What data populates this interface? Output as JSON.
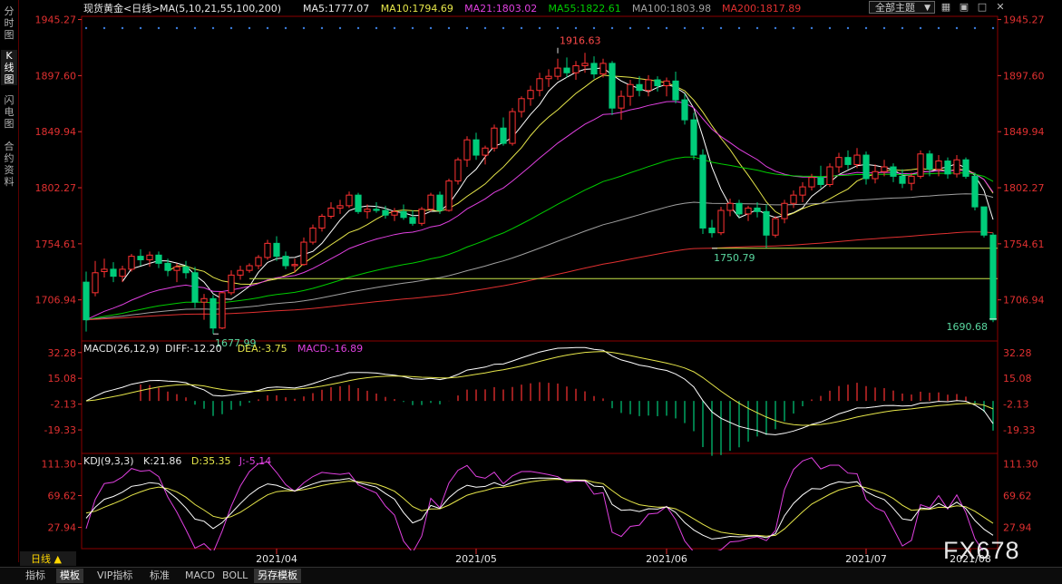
{
  "sidebar": {
    "tabs": [
      {
        "label": "分时图",
        "active": false
      },
      {
        "label": "K线图",
        "active": true
      },
      {
        "label": "闪电图",
        "active": false
      },
      {
        "label": "合约资料",
        "active": false
      }
    ]
  },
  "toolbar": {
    "theme_select": "全部主题",
    "theme_arrow": "▼",
    "icons": [
      "grid-icon",
      "chart-type-icon",
      "fullscreen-icon",
      "close-icon"
    ]
  },
  "bottom_tabs": [
    "指标",
    "模板",
    "VIP指标",
    "标准",
    "MACD",
    "BOLL",
    "另存模板"
  ],
  "bottom_active": "模板",
  "period": {
    "label": "日线 ▲"
  },
  "watermark": "FX678",
  "colors": {
    "up": "#ff3232",
    "down": "#00cc7a",
    "ma5": "#ffffff",
    "ma10": "#e6e64a",
    "ma21": "#e040e0",
    "ma55": "#00cc00",
    "ma100": "#a0a0a0",
    "ma200": "#e03030",
    "axis": "#e03030",
    "frame": "#8b0000"
  },
  "chart_data": [
    {
      "type": "candlestick",
      "title": "现货黄金<日线>",
      "ma_header": "MA(5,10,21,55,100,200)",
      "ma_values": [
        {
          "name": "MA5",
          "value": "1777.07"
        },
        {
          "name": "MA10",
          "value": "1794.69"
        },
        {
          "name": "MA21",
          "value": "1803.02"
        },
        {
          "name": "MA55",
          "value": "1822.61"
        },
        {
          "name": "MA100",
          "value": "1803.98"
        },
        {
          "name": "MA200",
          "value": "1817.89"
        }
      ],
      "yticks": [
        "1945.27",
        "1897.60",
        "1849.94",
        "1802.27",
        "1754.61",
        "1706.94"
      ],
      "ylim": [
        1672,
        1948
      ],
      "xticks": [
        "2021/04",
        "2021/05",
        "2021/06",
        "2021/07",
        "2021/08"
      ],
      "annotations": [
        {
          "text": "1916.63",
          "value": 1916.63,
          "index": 52
        },
        {
          "text": "1677.99",
          "value": 1677.99,
          "index": 14
        },
        {
          "text": "1750.79",
          "value": 1750.79,
          "index": 69
        },
        {
          "text": "1690.68",
          "value": 1690.68,
          "index": 100
        }
      ],
      "hlines": [
        1750.79,
        1725
      ],
      "ohlc": [
        [
          1722,
          1731,
          1680,
          1690
        ],
        [
          1713,
          1740,
          1710,
          1730
        ],
        [
          1731,
          1742,
          1726,
          1733
        ],
        [
          1733,
          1739,
          1722,
          1727
        ],
        [
          1727,
          1736,
          1722,
          1733
        ],
        [
          1733,
          1746,
          1731,
          1744
        ],
        [
          1744,
          1750,
          1736,
          1741
        ],
        [
          1741,
          1748,
          1735,
          1745
        ],
        [
          1745,
          1748,
          1734,
          1738
        ],
        [
          1738,
          1742,
          1727,
          1732
        ],
        [
          1732,
          1738,
          1722,
          1735
        ],
        [
          1735,
          1740,
          1725,
          1730
        ],
        [
          1730,
          1735,
          1700,
          1705
        ],
        [
          1705,
          1712,
          1690,
          1708
        ],
        [
          1708,
          1711,
          1678,
          1683
        ],
        [
          1683,
          1714,
          1682,
          1713
        ],
        [
          1713,
          1732,
          1711,
          1728
        ],
        [
          1728,
          1736,
          1724,
          1732
        ],
        [
          1732,
          1738,
          1730,
          1736
        ],
        [
          1736,
          1745,
          1733,
          1743
        ],
        [
          1743,
          1758,
          1741,
          1755
        ],
        [
          1755,
          1761,
          1740,
          1744
        ],
        [
          1744,
          1748,
          1733,
          1736
        ],
        [
          1736,
          1742,
          1730,
          1737
        ],
        [
          1737,
          1760,
          1736,
          1756
        ],
        [
          1756,
          1771,
          1754,
          1768
        ],
        [
          1768,
          1780,
          1765,
          1778
        ],
        [
          1778,
          1790,
          1776,
          1785
        ],
        [
          1785,
          1792,
          1780,
          1787
        ],
        [
          1787,
          1799,
          1785,
          1796
        ],
        [
          1796,
          1798,
          1780,
          1782
        ],
        [
          1782,
          1788,
          1776,
          1784
        ],
        [
          1784,
          1790,
          1781,
          1783
        ],
        [
          1783,
          1787,
          1776,
          1779
        ],
        [
          1779,
          1785,
          1774,
          1782
        ],
        [
          1782,
          1788,
          1775,
          1777
        ],
        [
          1777,
          1783,
          1770,
          1772
        ],
        [
          1772,
          1786,
          1770,
          1784
        ],
        [
          1784,
          1798,
          1782,
          1796
        ],
        [
          1796,
          1799,
          1780,
          1783
        ],
        [
          1783,
          1810,
          1782,
          1808
        ],
        [
          1808,
          1828,
          1805,
          1826
        ],
        [
          1826,
          1846,
          1820,
          1843
        ],
        [
          1843,
          1849,
          1826,
          1830
        ],
        [
          1830,
          1838,
          1822,
          1836
        ],
        [
          1836,
          1856,
          1833,
          1853
        ],
        [
          1853,
          1862,
          1838,
          1840
        ],
        [
          1840,
          1870,
          1838,
          1867
        ],
        [
          1867,
          1880,
          1862,
          1878
        ],
        [
          1878,
          1889,
          1872,
          1885
        ],
        [
          1885,
          1900,
          1880,
          1895
        ],
        [
          1895,
          1903,
          1888,
          1897
        ],
        [
          1897,
          1912,
          1894,
          1904
        ],
        [
          1904,
          1913,
          1896,
          1900
        ],
        [
          1900,
          1910,
          1894,
          1906
        ],
        [
          1906,
          1917,
          1900,
          1908
        ],
        [
          1908,
          1914,
          1895,
          1899
        ],
        [
          1899,
          1912,
          1896,
          1908
        ],
        [
          1908,
          1910,
          1864,
          1870
        ],
        [
          1870,
          1885,
          1860,
          1880
        ],
        [
          1880,
          1894,
          1872,
          1890
        ],
        [
          1890,
          1897,
          1880,
          1885
        ],
        [
          1885,
          1898,
          1880,
          1894
        ],
        [
          1894,
          1897,
          1884,
          1889
        ],
        [
          1889,
          1896,
          1880,
          1893
        ],
        [
          1893,
          1901,
          1874,
          1877
        ],
        [
          1877,
          1882,
          1856,
          1860
        ],
        [
          1860,
          1866,
          1826,
          1830
        ],
        [
          1830,
          1835,
          1763,
          1768
        ],
        [
          1768,
          1775,
          1760,
          1764
        ],
        [
          1764,
          1786,
          1762,
          1783
        ],
        [
          1783,
          1793,
          1778,
          1789
        ],
        [
          1789,
          1792,
          1777,
          1780
        ],
        [
          1780,
          1787,
          1774,
          1785
        ],
        [
          1785,
          1790,
          1777,
          1782
        ],
        [
          1782,
          1788,
          1751,
          1762
        ],
        [
          1762,
          1778,
          1760,
          1776
        ],
        [
          1776,
          1792,
          1772,
          1789
        ],
        [
          1789,
          1800,
          1785,
          1796
        ],
        [
          1796,
          1807,
          1790,
          1803
        ],
        [
          1803,
          1814,
          1800,
          1811
        ],
        [
          1811,
          1821,
          1802,
          1805
        ],
        [
          1805,
          1823,
          1803,
          1820
        ],
        [
          1820,
          1832,
          1815,
          1828
        ],
        [
          1828,
          1834,
          1818,
          1822
        ],
        [
          1822,
          1836,
          1819,
          1830
        ],
        [
          1830,
          1833,
          1805,
          1810
        ],
        [
          1810,
          1822,
          1806,
          1816
        ],
        [
          1816,
          1826,
          1812,
          1820
        ],
        [
          1820,
          1823,
          1807,
          1812
        ],
        [
          1812,
          1818,
          1802,
          1806
        ],
        [
          1806,
          1815,
          1800,
          1812
        ],
        [
          1812,
          1834,
          1810,
          1831
        ],
        [
          1831,
          1834,
          1812,
          1818
        ],
        [
          1818,
          1830,
          1812,
          1825
        ],
        [
          1825,
          1828,
          1810,
          1814
        ],
        [
          1814,
          1830,
          1811,
          1826
        ],
        [
          1826,
          1828,
          1810,
          1812
        ],
        [
          1812,
          1815,
          1783,
          1786
        ],
        [
          1786,
          1764,
          1760,
          1762
        ],
        [
          1762,
          1764,
          1688,
          1690
        ]
      ]
    },
    {
      "type": "bar",
      "title": "MACD(26,12,9)",
      "values_text": [
        {
          "name": "DIFF",
          "value": "-12.20"
        },
        {
          "name": "DEA",
          "value": "-3.75"
        },
        {
          "name": "MACD",
          "value": "-16.89"
        }
      ],
      "yticks": [
        "32.28",
        "15.08",
        "-2.13",
        "-19.33"
      ],
      "ylim": [
        -35,
        40
      ]
    },
    {
      "type": "line",
      "title": "KDJ(9,3,3)",
      "values_text": [
        {
          "name": "K",
          "value": "21.86"
        },
        {
          "name": "D",
          "value": "35.35"
        },
        {
          "name": "J",
          "value": "-5.14"
        }
      ],
      "yticks": [
        "111.30",
        "69.62",
        "27.94"
      ],
      "ylim": [
        0,
        125
      ]
    }
  ]
}
